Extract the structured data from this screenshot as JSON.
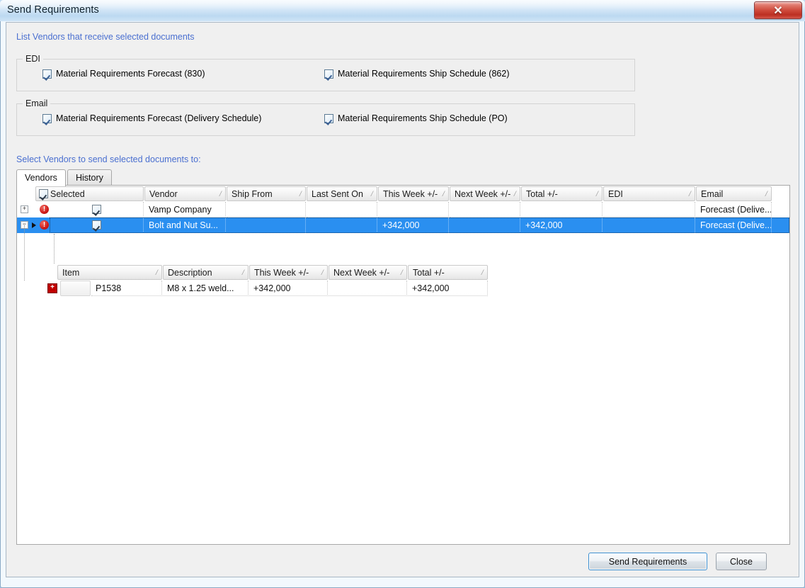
{
  "window": {
    "title": "Send Requirements",
    "close_glyph": "✕",
    "close_icon": "window-close-icon"
  },
  "captions": {
    "list_vendors": "List Vendors that receive selected documents",
    "select_vendors": "Select Vendors to send selected documents to:"
  },
  "groups": [
    {
      "legend": "EDI",
      "checkboxes": [
        {
          "label": "Material Requirements Forecast (830)",
          "checked": true
        },
        {
          "label": "Material Requirements Ship Schedule (862)",
          "checked": true
        }
      ]
    },
    {
      "legend": "Email",
      "checkboxes": [
        {
          "label": "Material Requirements Forecast (Delivery Schedule)",
          "checked": true
        },
        {
          "label": "Material Requirements Ship Schedule (PO)",
          "checked": true
        }
      ]
    }
  ],
  "tabs": [
    {
      "label": "Vendors",
      "active": true
    },
    {
      "label": "History",
      "active": false
    }
  ],
  "vendor_grid": {
    "select_all_checked": true,
    "columns": [
      {
        "label": "Selected",
        "sortable": false,
        "has_checkbox": true
      },
      {
        "label": "Vendor",
        "sortable": true
      },
      {
        "label": "Ship From",
        "sortable": true
      },
      {
        "label": "Last Sent On",
        "sortable": true
      },
      {
        "label": "This Week +/-",
        "sortable": true
      },
      {
        "label": "Next Week +/-",
        "sortable": true
      },
      {
        "label": "Total +/-",
        "sortable": true
      },
      {
        "label": "EDI",
        "sortable": true
      },
      {
        "label": "Email",
        "sortable": true
      }
    ],
    "sort_glyph": "⁄",
    "rows": [
      {
        "expander": "+",
        "error": true,
        "error_glyph": "!",
        "current": false,
        "selected_checkbox": true,
        "vendor": "Vamp Company",
        "ship_from": "",
        "last_sent_on": "",
        "this_week": "",
        "next_week": "",
        "total": "",
        "edi": "",
        "email": "Forecast  (Delive..."
      },
      {
        "expander": "−",
        "error": true,
        "error_glyph": "!",
        "current": true,
        "selected_checkbox": true,
        "vendor": "Bolt and Nut Su...",
        "ship_from": "",
        "last_sent_on": "",
        "this_week": "+342,000",
        "next_week": "",
        "total": "+342,000",
        "edi": "",
        "email": "Forecast  (Delive..."
      }
    ]
  },
  "item_grid": {
    "columns": [
      {
        "label": "Item",
        "sortable": true
      },
      {
        "label": "Description",
        "sortable": true
      },
      {
        "label": "This Week +/-",
        "sortable": true
      },
      {
        "label": "Next Week +/-",
        "sortable": true
      },
      {
        "label": "Total +/-",
        "sortable": true
      }
    ],
    "sort_glyph": "⁄",
    "rows": [
      {
        "expander": "+",
        "item": "P1538",
        "description": "M8 x 1.25 weld...",
        "this_week": "+342,000",
        "next_week": "",
        "total": "+342,000"
      }
    ]
  },
  "footer": {
    "send_label": "Send Requirements",
    "close_label": "Close"
  },
  "colors": {
    "caption_blue": "#4a6fd0",
    "selection_blue": "#2a8ff0",
    "error_red": "#d01b18",
    "expand_red": "#c00000",
    "default_button_border": "#3c8fd0"
  }
}
